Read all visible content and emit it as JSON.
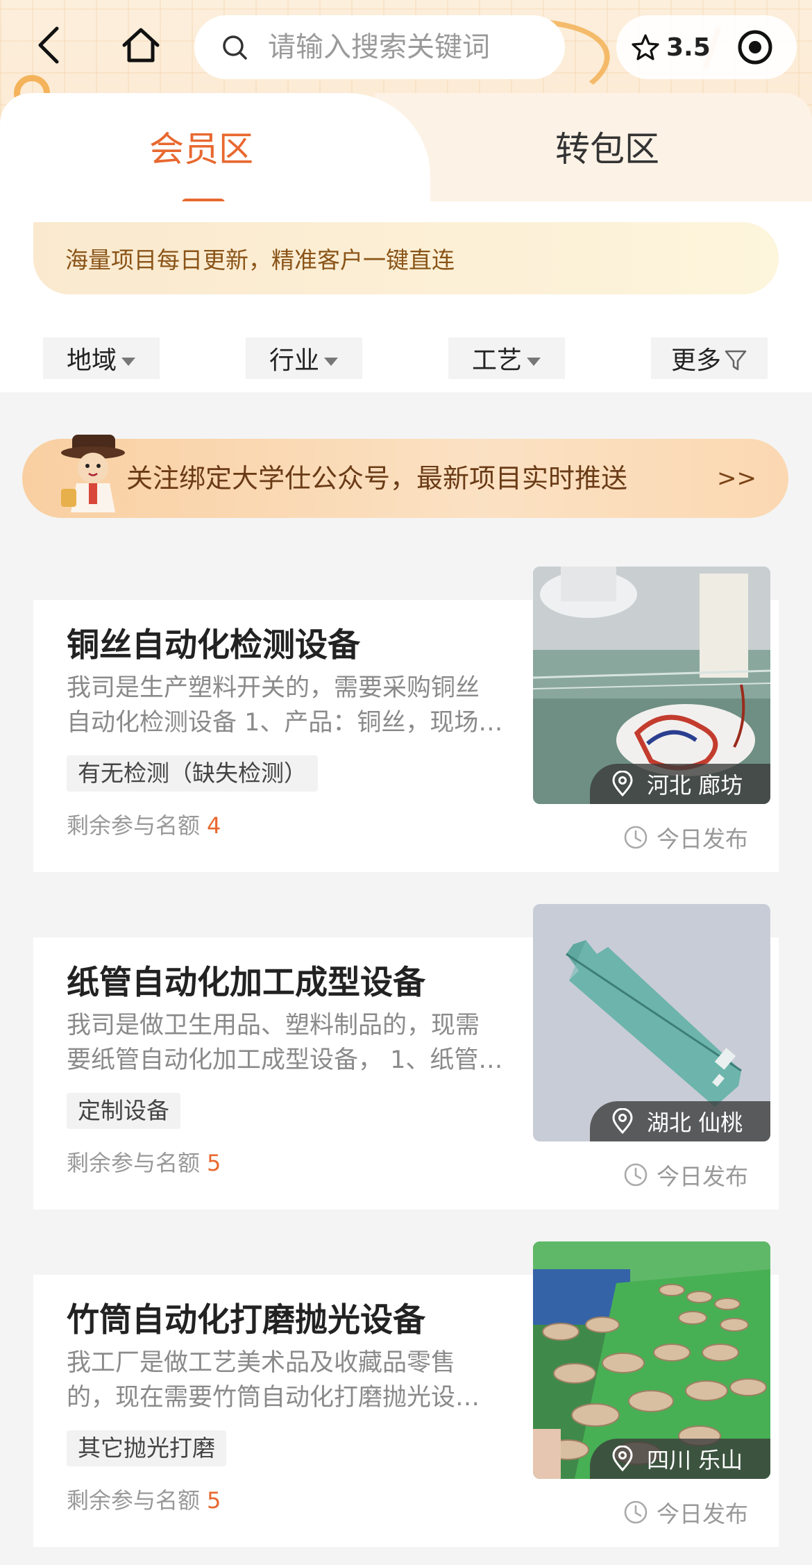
{
  "header": {
    "search_placeholder": "请输入搜索关键词",
    "rating": "3.5"
  },
  "tabs": [
    {
      "label": "会员区",
      "active": true
    },
    {
      "label": "转包区",
      "active": false
    }
  ],
  "notice": "海量项目每日更新，精准客户一键直连",
  "filters": [
    {
      "label": "地域",
      "icon": "caret-down-icon"
    },
    {
      "label": "行业",
      "icon": "caret-down-icon"
    },
    {
      "label": "工艺",
      "icon": "caret-down-icon"
    },
    {
      "label": "更多",
      "icon": "filter-icon"
    }
  ],
  "promo": {
    "text": "关注绑定大学仕公众号，最新项目实时推送",
    "arrow": ">>"
  },
  "quota_label": "剩余参与名额",
  "projects": [
    {
      "title": "铜丝自动化检测设备",
      "desc_line1": "我司是生产塑料开关的，需要采购铜丝",
      "desc_line2": "自动化检测设备 1、产品：铜丝，现场…",
      "tag": "有无检测（缺失检测）",
      "quota": "4",
      "location": "河北 廊坊",
      "publish": "今日发布"
    },
    {
      "title": "纸管自动化加工成型设备",
      "desc_line1": "我司是做卫生用品、塑料制品的，现需",
      "desc_line2": "要纸管自动化加工成型设备， 1、纸管…",
      "tag": "定制设备",
      "quota": "5",
      "location": "湖北 仙桃",
      "publish": "今日发布"
    },
    {
      "title": "竹筒自动化打磨抛光设备",
      "desc_line1": "我工厂是做工艺美术品及收藏品零售",
      "desc_line2": "的，现在需要竹筒自动化打磨抛光设…",
      "tag": "其它抛光打磨",
      "quota": "5",
      "location": "四川 乐山",
      "publish": "今日发布"
    }
  ],
  "colors": {
    "accent": "#e8682f",
    "notice_text": "#8a5418",
    "promo_text": "#6a3b16"
  }
}
